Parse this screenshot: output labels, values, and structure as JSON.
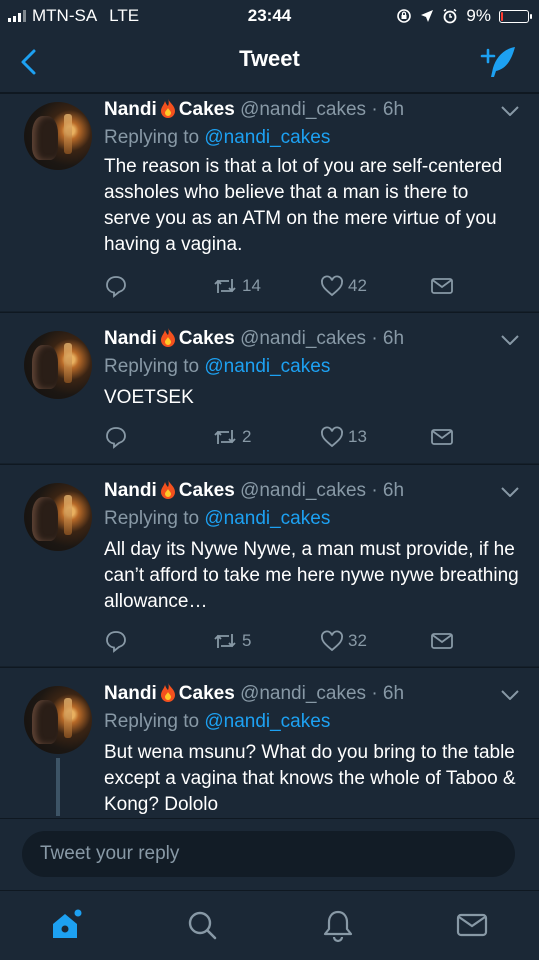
{
  "status_bar": {
    "carrier": "MTN-SA",
    "network": "LTE",
    "time": "23:44",
    "battery": "9%",
    "battery_level": 0.09,
    "battery_color": "#ff3b30"
  },
  "nav": {
    "title": "Tweet",
    "back_icon": "chevron-left-icon",
    "compose_icon": "compose-quill-icon"
  },
  "colors": {
    "background": "#15202b",
    "card": "#1b2836",
    "accent": "#1da1f2",
    "muted": "#8899a6"
  },
  "tweets": [
    {
      "name_first": "Nandi",
      "name_emoji": "fire-emoji",
      "name_last": "Cakes",
      "handle": "@nandi_cakes",
      "time": "· 6h",
      "reply_prefix": "Replying to",
      "reply_to": "@nandi_cakes",
      "text": "The reason is that a lot of you are self-centered assholes who believe that a man is there to serve you as an ATM on the mere virtue of you having a vagina.",
      "retweets": "14",
      "likes": "42"
    },
    {
      "name_first": "Nandi",
      "name_emoji": "fire-emoji",
      "name_last": "Cakes",
      "handle": "@nandi_cakes",
      "time": "· 6h",
      "reply_prefix": "Replying to",
      "reply_to": "@nandi_cakes",
      "text": "VOETSEK",
      "retweets": "2",
      "likes": "13"
    },
    {
      "name_first": "Nandi",
      "name_emoji": "fire-emoji",
      "name_last": "Cakes",
      "handle": "@nandi_cakes",
      "time": "· 6h",
      "reply_prefix": "Replying to",
      "reply_to": "@nandi_cakes",
      "text": "All day its Nywe Nywe, a man must provide, if he can’t afford to take me here nywe nywe breathing allowance…",
      "retweets": "5",
      "likes": "32"
    },
    {
      "name_first": "Nandi",
      "name_emoji": "fire-emoji",
      "name_last": "Cakes",
      "handle": "@nandi_cakes",
      "time": "· 6h",
      "reply_prefix": "Replying to",
      "reply_to": "@nandi_cakes",
      "text": "But wena msunu? What do you bring to the table except a vagina that knows the whole of Taboo & Kong? Dololo"
    }
  ],
  "reply_bar": {
    "placeholder": "Tweet your reply"
  },
  "tab_bar": {
    "items": [
      "home-icon",
      "search-icon",
      "notifications-bell-icon",
      "messages-envelope-icon"
    ],
    "active": "home-icon"
  }
}
